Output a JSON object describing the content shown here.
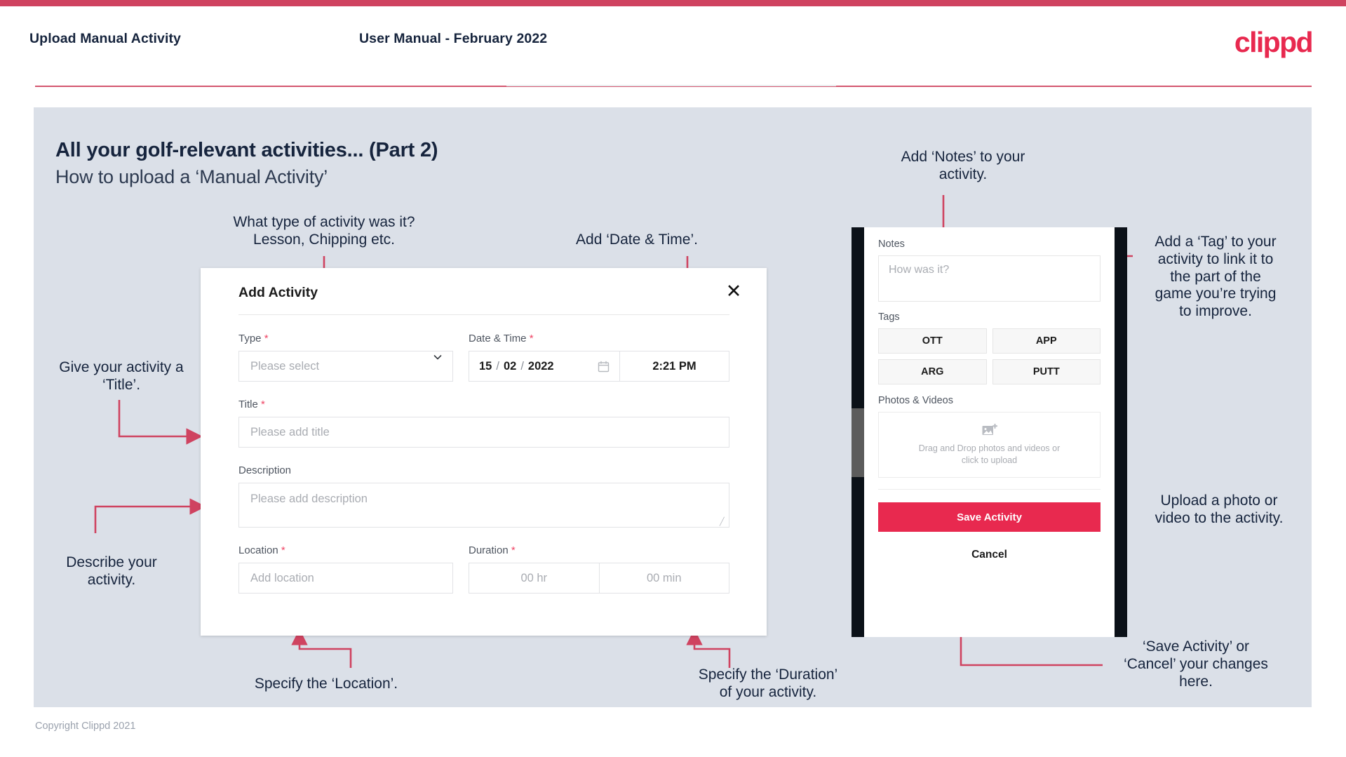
{
  "header": {
    "left_title": "Upload Manual Activity",
    "center_title": "User Manual - February 2022",
    "logo": "clippd"
  },
  "slide": {
    "title_line1": "All your golf-relevant activities... (Part 2)",
    "title_line2": "How to upload a ‘Manual Activity’",
    "copyright": "Copyright Clippd 2021"
  },
  "dialog": {
    "title": "Add Activity",
    "close_icon": "close-icon",
    "fields": {
      "type": {
        "label": "Type",
        "required": "*",
        "placeholder": "Please select"
      },
      "datetime": {
        "label": "Date & Time",
        "required": "*",
        "day": "15",
        "month": "02",
        "year": "2022",
        "sep": "/",
        "time": "2:21 PM"
      },
      "title": {
        "label": "Title",
        "required": "*",
        "placeholder": "Please add title"
      },
      "description": {
        "label": "Description",
        "placeholder": "Please add description"
      },
      "location": {
        "label": "Location",
        "required": "*",
        "placeholder": "Add location"
      },
      "duration": {
        "label": "Duration",
        "required": "*",
        "hours": "00 hr",
        "minutes": "00 min"
      }
    }
  },
  "phone": {
    "notes": {
      "label": "Notes",
      "placeholder": "How was it?"
    },
    "tags": {
      "label": "Tags",
      "items": [
        "OTT",
        "APP",
        "ARG",
        "PUTT"
      ]
    },
    "photos": {
      "label": "Photos & Videos",
      "dropzone_line1": "Drag and Drop photos and videos or",
      "dropzone_line2": "click to upload"
    },
    "save_label": "Save Activity",
    "cancel_label": "Cancel"
  },
  "annotations": {
    "type": "What type of activity was it?\nLesson, Chipping etc.",
    "datetime": "Add ‘Date & Time’.",
    "title": "Give your activity a\n‘Title’.",
    "description": "Describe your\nactivity.",
    "location": "Specify the ‘Location’.",
    "duration": "Specify the ‘Duration’\nof your activity.",
    "notes": "Add ‘Notes’ to your\nactivity.",
    "tags": "Add a ‘Tag’ to your\nactivity to link it to\nthe part of the\ngame you’re trying\nto improve.",
    "photos": "Upload a photo or\nvideo to the activity.",
    "save": "‘Save Activity’ or\n‘Cancel’ your changes\nhere."
  },
  "colors": {
    "brand_red": "#e8294f",
    "annotation_line": "#cf4360",
    "slide_bg": "#dbe0e8",
    "ink": "#16243d"
  }
}
